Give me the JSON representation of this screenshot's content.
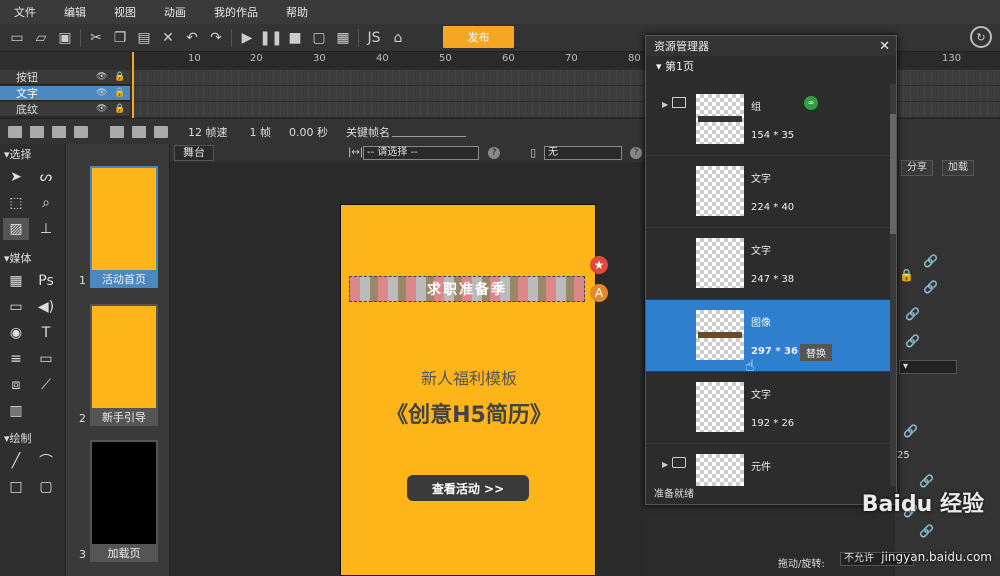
{
  "menu": [
    "文件",
    "编辑",
    "视图",
    "动画",
    "我的作品",
    "帮助"
  ],
  "toolbar": {
    "publish_label": "发布"
  },
  "timeline": {
    "ruler": [
      "10",
      "20",
      "30",
      "40",
      "50",
      "60",
      "70",
      "80",
      "130"
    ],
    "layers": [
      {
        "name": "按钮",
        "active": false
      },
      {
        "name": "文字",
        "active": true
      },
      {
        "name": "底纹",
        "active": false
      }
    ]
  },
  "framebar": {
    "fps": "12 帧速",
    "frame": "1 帧",
    "time": "0.00 秒",
    "keyframe_label": "关键帧名"
  },
  "tools": {
    "select_header": "选择",
    "media_header": "媒体",
    "draw_header": "绘制"
  },
  "pages": [
    {
      "num": "1",
      "label": "活动首页"
    },
    {
      "num": "2",
      "label": "新手引导"
    },
    {
      "num": "3",
      "label": "加载页"
    }
  ],
  "stage": {
    "tab": "舞台",
    "select1": "-- 请选择 --",
    "select2": "无",
    "help": "?",
    "banner_text": "求职准备季",
    "subtitle": "新人福利模板",
    "title": "《创意H5简历》",
    "button": "查看活动 >>"
  },
  "resource_manager": {
    "title": "资源管理器",
    "page": "第1页",
    "items": [
      {
        "type": "组",
        "size": "154 * 35"
      },
      {
        "type": "文字",
        "size": "224 * 40"
      },
      {
        "type": "文字",
        "size": "247 * 38"
      },
      {
        "type": "图像",
        "size": "297 * 36",
        "action": "替换"
      },
      {
        "type": "文字",
        "size": "192 * 26"
      },
      {
        "type": "元件",
        "size": ""
      }
    ],
    "status": "准备就绪"
  },
  "properties": {
    "tab_share": "分享",
    "tab_load": "加载",
    "rotate_label": "拖动/旋转:",
    "rotate_value": "不允许",
    "value_25": "25"
  },
  "watermark": {
    "brand": "Baidu 经验",
    "url": "jingyan.baidu.com"
  },
  "colors": {
    "accent": "#f5a623",
    "selection": "#2f7fcf",
    "artboard": "#fdb51a"
  }
}
